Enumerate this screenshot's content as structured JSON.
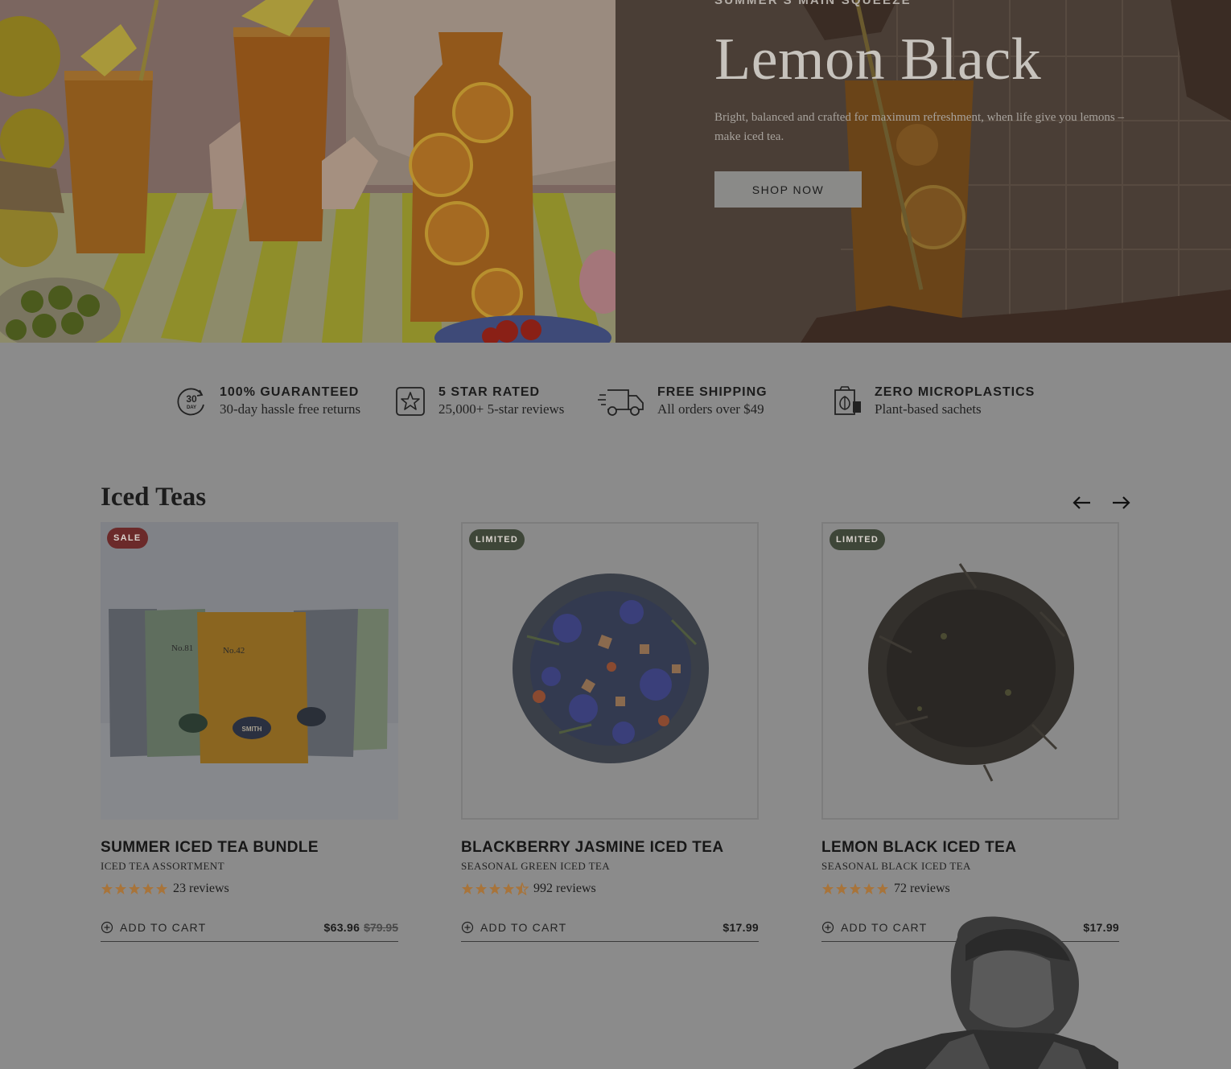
{
  "hero": {
    "eyebrow": "SUMMER'S MAIN SQUEEZE",
    "title": "Lemon Black",
    "description": "Bright, balanced and crafted for maximum refreshment, when life give you lemons – make iced tea.",
    "cta_label": "SHOP NOW"
  },
  "features": [
    {
      "icon": "30-day-returns-icon",
      "icon_text": "30",
      "icon_subtext": "DAY",
      "title": "100% GUARANTEED",
      "subtitle": "30-day hassle free returns"
    },
    {
      "icon": "star-badge-icon",
      "title": "5 STAR RATED",
      "subtitle": "25,000+ 5-star reviews"
    },
    {
      "icon": "delivery-truck-icon",
      "title": "FREE SHIPPING",
      "subtitle": "All orders over $49"
    },
    {
      "icon": "plant-sachet-icon",
      "title": "ZERO MICROPLASTICS",
      "subtitle": "Plant-based sachets"
    }
  ],
  "iced_teas": {
    "section_title": "Iced Teas",
    "prev_icon": "arrow-left-icon",
    "next_icon": "arrow-right-icon",
    "products": [
      {
        "badge": "SALE",
        "name": "SUMMER ICED TEA BUNDLE",
        "type": "ICED TEA ASSORTMENT",
        "rating": 5,
        "reviews": "23 reviews",
        "add_to_cart": "ADD TO CART",
        "price": "$63.96",
        "original_price": "$79.95",
        "pouch_labels": [
          "No.81",
          "No.42",
          "SMITH"
        ]
      },
      {
        "badge": "LIMITED",
        "name": "BLACKBERRY JASMINE ICED TEA",
        "type": "SEASONAL GREEN ICED TEA",
        "rating": 4.5,
        "reviews": "992 reviews",
        "add_to_cart": "ADD TO CART",
        "price": "$17.99"
      },
      {
        "badge": "LIMITED",
        "name": "LEMON BLACK ICED TEA",
        "type": "SEASONAL BLACK ICED TEA",
        "rating": 5,
        "reviews": "72 reviews",
        "add_to_cart": "ADD TO CART",
        "price": "$17.99"
      }
    ]
  },
  "colors": {
    "overlay_gray": "#8b8b8b",
    "star": "#a8743a",
    "sale_badge": "#6b2a2a",
    "limited_badge": "#3e4638"
  }
}
